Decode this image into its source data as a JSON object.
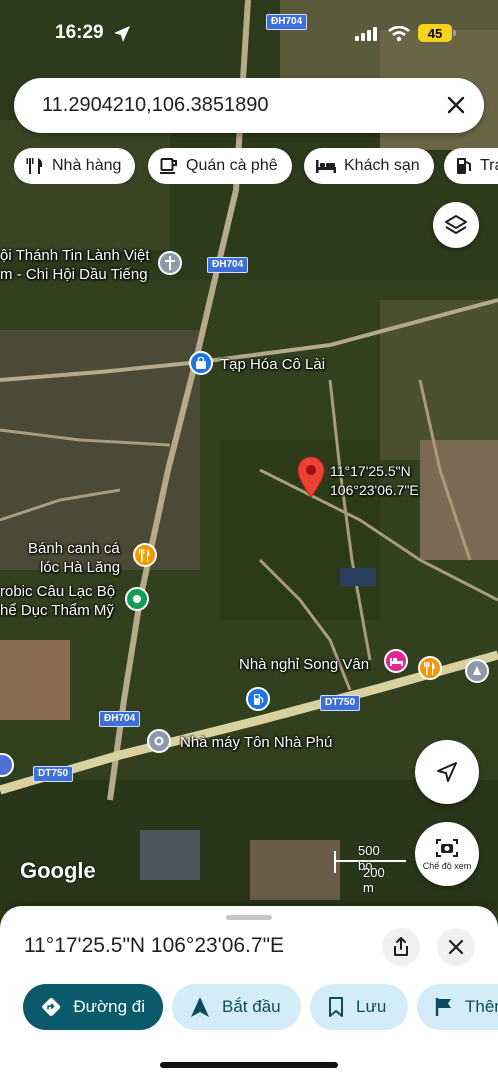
{
  "status_bar": {
    "time": "16:29",
    "battery": "45"
  },
  "search": {
    "query": "11.2904210,106.3851890"
  },
  "chips": [
    {
      "icon": "restaurant-icon",
      "label": "Nhà hàng"
    },
    {
      "icon": "coffee-icon",
      "label": "Quán cà phê"
    },
    {
      "icon": "bed-icon",
      "label": "Khách sạn"
    },
    {
      "icon": "gas-station-icon",
      "label": "Trạm xăng"
    }
  ],
  "map": {
    "road_shields": [
      "ĐH704",
      "ĐH704",
      "DT750",
      "ĐH704",
      "DT750"
    ],
    "places": {
      "church_line1": "ội Thánh Tin Lành Việt",
      "church_line2": "m - Chi Hội Dầu Tiếng",
      "shop": "Tạp Hóa Cô Lài",
      "pin_lat": "11°17'25.5\"N",
      "pin_lng": "106°23'06.7\"E",
      "noodle_line1": "Bánh canh cá",
      "noodle_line2": "lóc Hà Lăng",
      "club_line1": "robic Câu Lạc Bộ",
      "club_line2": "hể Dục Thẩm Mỹ",
      "motel": "Nhà nghỉ Song Vân",
      "factory": "Nhà máy Tôn Nhà Phú"
    },
    "google_logo": "Google",
    "scale_ft": "500 bộ",
    "scale_m": "200 m",
    "camera_label": "Chế độ xem"
  },
  "sheet": {
    "title": "11°17'25.5\"N 106°23'06.7\"E",
    "actions": [
      {
        "icon": "directions-icon",
        "label": "Đường đi"
      },
      {
        "icon": "navigation-arrow-icon",
        "label": "Bắt đầu"
      },
      {
        "icon": "bookmark-icon",
        "label": "Lưu"
      },
      {
        "icon": "flag-icon",
        "label": "Thêm nhãn"
      }
    ]
  },
  "colors": {
    "primary": "#0b5a6b",
    "secondary": "#d3ecf7",
    "pin": "#ea4335"
  }
}
